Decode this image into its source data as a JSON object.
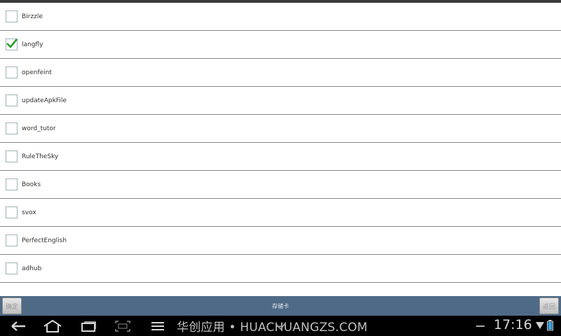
{
  "list": {
    "items": [
      {
        "label": "Birzzle",
        "checked": false
      },
      {
        "label": "langfly",
        "checked": true
      },
      {
        "label": "openfeint",
        "checked": false
      },
      {
        "label": "updateApkFile",
        "checked": false
      },
      {
        "label": "word_tutor",
        "checked": false
      },
      {
        "label": "RuleTheSky",
        "checked": false
      },
      {
        "label": "Books",
        "checked": false
      },
      {
        "label": "svox",
        "checked": false
      },
      {
        "label": "PerfectEnglish",
        "checked": false
      },
      {
        "label": "adhub",
        "checked": false
      }
    ]
  },
  "bottom_bar": {
    "confirm_label": "确定",
    "title": "存储卡",
    "back_label": "返回",
    "color": "#4f6a87"
  },
  "nav_bar": {
    "watermark": "华创应用 • HUACHUANGZS.COM",
    "time": "17:16",
    "icons": [
      "back-icon",
      "home-icon",
      "recent-apps-icon",
      "screenshot-icon",
      "menu-icon",
      "keyboard-hide-icon",
      "wifi-icon",
      "battery-icon"
    ]
  },
  "accent_check_color": "#2e9b2e"
}
